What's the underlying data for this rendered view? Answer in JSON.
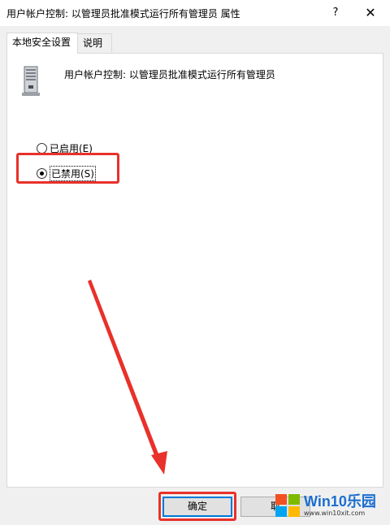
{
  "window": {
    "title": "用户帐户控制: 以管理员批准模式运行所有管理员 属性",
    "help_label": "?",
    "close_label": "✕"
  },
  "tabs": [
    {
      "label": "本地安全设置",
      "active": true
    },
    {
      "label": "说明",
      "active": false
    }
  ],
  "policy": {
    "title": "用户帐户控制: 以管理员批准模式运行所有管理员"
  },
  "options": [
    {
      "label": "已启用(E)",
      "checked": false
    },
    {
      "label": "已禁用(S)",
      "checked": true
    }
  ],
  "buttons": {
    "ok_label": "确定",
    "cancel_label": "取"
  },
  "watermark": {
    "main": "Win10乐园",
    "sub": "www.win10xit.com"
  },
  "colors": {
    "annotation": "#e8312a",
    "accent": "#0078d7"
  }
}
